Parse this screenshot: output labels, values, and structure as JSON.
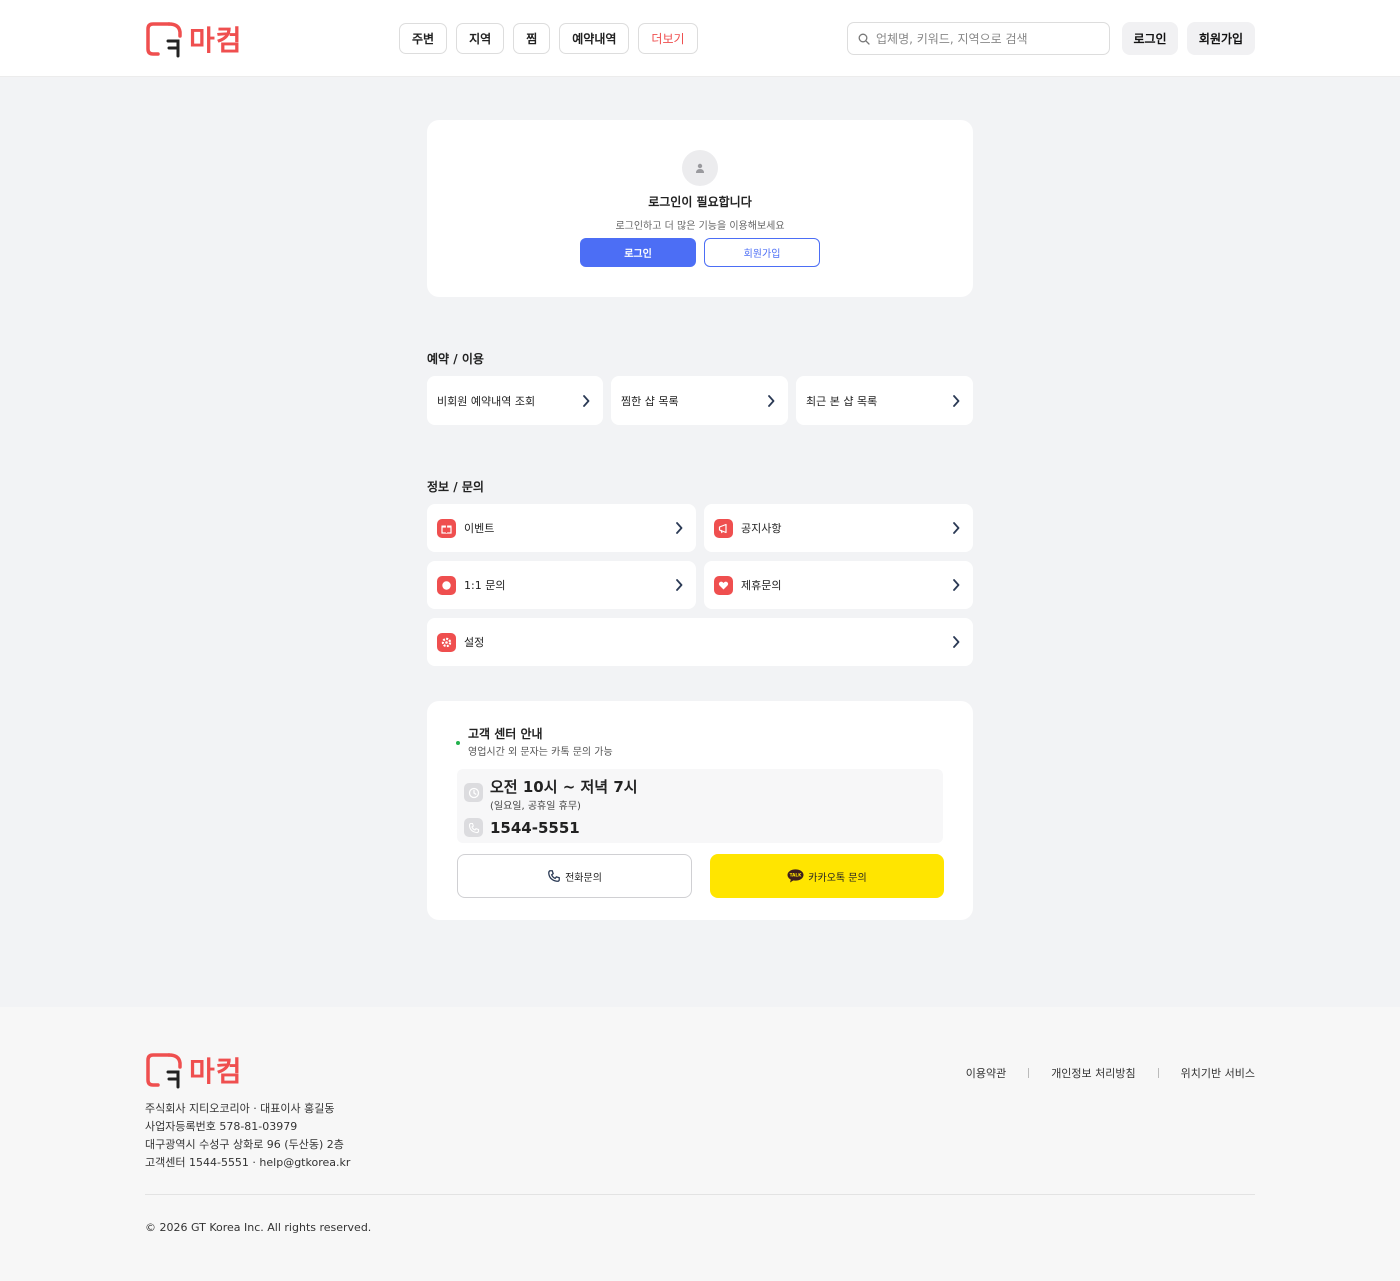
{
  "brand": {
    "name": "마컴",
    "color": "#ef4f4f"
  },
  "header": {
    "nav": [
      "주변",
      "지역",
      "찜",
      "예약내역",
      "더보기"
    ],
    "search_placeholder": "업체명, 키워드, 지역으로 검색",
    "login": "로그인",
    "signup": "회원가입"
  },
  "login_card": {
    "title": "로그인이 필요합니다",
    "subtitle": "로그인하고 더 많은 기능을 이용해보세요",
    "login_button": "로그인",
    "signup_button": "회원가입",
    "primary_color": "#4c6ef5"
  },
  "reservation": {
    "title": "예약 / 이용",
    "items": [
      "비회원 예약내역 조회",
      "찜한 샵 목록",
      "최근 본 샵 목록"
    ]
  },
  "info": {
    "title": "정보 / 문의",
    "items": [
      {
        "label": "이벤트",
        "icon": "gift-icon"
      },
      {
        "label": "공지사항",
        "icon": "megaphone-icon"
      },
      {
        "label": "1:1 문의",
        "icon": "chat-icon"
      },
      {
        "label": "제휴문의",
        "icon": "heart-icon"
      },
      {
        "label": "설정",
        "icon": "gear-icon"
      }
    ]
  },
  "customer_center": {
    "title": "고객 센터 안내",
    "subtitle": "영업시간 외 문자는 카톡 문의 가능",
    "hours": "오전 10시 ~ 저녁 7시",
    "hours_note": "(일요일, 공휴일 휴무)",
    "phone": "1544-5551",
    "call_button": "전화문의",
    "kakao_button": "카카오톡 문의",
    "kakao_badge": "TALK",
    "kakao_color": "#ffe500"
  },
  "footer": {
    "company": "주식회사 지티오코리아 · 대표이사 홍길동",
    "business_no": "사업자등록번호 578-81-03979",
    "address": "대구광역시 수성구 상화로 96 (두산동) 2층",
    "contact": "고객센터 1544-5551 · help@gtkorea.kr",
    "links": [
      "이용약관",
      "개인정보 처리방침",
      "위치기반 서비스"
    ],
    "copyright": "© 2026 GT Korea Inc. All rights reserved."
  }
}
